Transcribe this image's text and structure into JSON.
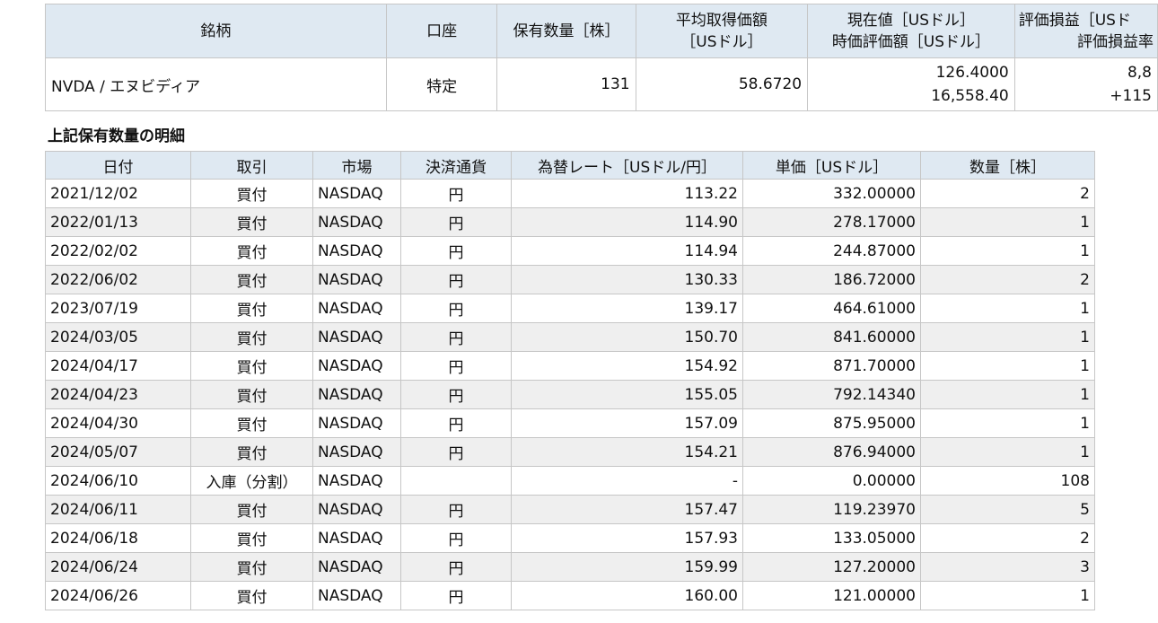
{
  "summary": {
    "headers": {
      "brand": "銘柄",
      "account": "口座",
      "quantity": "保有数量［株］",
      "avg_cost_1": "平均取得価額",
      "avg_cost_2": "［USドル］",
      "current_1": "現在値［USドル］",
      "current_2": "時価評価額［USドル］",
      "pl_1": "評価損益［USド",
      "pl_2": "評価損益率"
    },
    "row": {
      "brand": "NVDA / エヌビディア",
      "account": "特定",
      "quantity": "131",
      "avg_cost": "58.6720",
      "current_price": "126.4000",
      "market_value": "16,558.40",
      "pl": "8,8",
      "pl_rate": "+115"
    }
  },
  "detail": {
    "title": "上記保有数量の明細",
    "headers": {
      "date": "日付",
      "trade": "取引",
      "market": "市場",
      "currency": "決済通貨",
      "fx": "為替レート［USドル/円］",
      "price": "単価［USドル］",
      "qty": "数量［株］"
    },
    "rows": [
      {
        "date": "2021/12/02",
        "trade": "買付",
        "market": "NASDAQ",
        "currency": "円",
        "fx": "113.22",
        "price": "332.00000",
        "qty": "2"
      },
      {
        "date": "2022/01/13",
        "trade": "買付",
        "market": "NASDAQ",
        "currency": "円",
        "fx": "114.90",
        "price": "278.17000",
        "qty": "1"
      },
      {
        "date": "2022/02/02",
        "trade": "買付",
        "market": "NASDAQ",
        "currency": "円",
        "fx": "114.94",
        "price": "244.87000",
        "qty": "1"
      },
      {
        "date": "2022/06/02",
        "trade": "買付",
        "market": "NASDAQ",
        "currency": "円",
        "fx": "130.33",
        "price": "186.72000",
        "qty": "2"
      },
      {
        "date": "2023/07/19",
        "trade": "買付",
        "market": "NASDAQ",
        "currency": "円",
        "fx": "139.17",
        "price": "464.61000",
        "qty": "1"
      },
      {
        "date": "2024/03/05",
        "trade": "買付",
        "market": "NASDAQ",
        "currency": "円",
        "fx": "150.70",
        "price": "841.60000",
        "qty": "1"
      },
      {
        "date": "2024/04/17",
        "trade": "買付",
        "market": "NASDAQ",
        "currency": "円",
        "fx": "154.92",
        "price": "871.70000",
        "qty": "1"
      },
      {
        "date": "2024/04/23",
        "trade": "買付",
        "market": "NASDAQ",
        "currency": "円",
        "fx": "155.05",
        "price": "792.14340",
        "qty": "1"
      },
      {
        "date": "2024/04/30",
        "trade": "買付",
        "market": "NASDAQ",
        "currency": "円",
        "fx": "157.09",
        "price": "875.95000",
        "qty": "1"
      },
      {
        "date": "2024/05/07",
        "trade": "買付",
        "market": "NASDAQ",
        "currency": "円",
        "fx": "154.21",
        "price": "876.94000",
        "qty": "1"
      },
      {
        "date": "2024/06/10",
        "trade": "入庫（分割）",
        "market": "NASDAQ",
        "currency": "",
        "fx": "-",
        "price": "0.00000",
        "qty": "108"
      },
      {
        "date": "2024/06/11",
        "trade": "買付",
        "market": "NASDAQ",
        "currency": "円",
        "fx": "157.47",
        "price": "119.23970",
        "qty": "5"
      },
      {
        "date": "2024/06/18",
        "trade": "買付",
        "market": "NASDAQ",
        "currency": "円",
        "fx": "157.93",
        "price": "133.05000",
        "qty": "2"
      },
      {
        "date": "2024/06/24",
        "trade": "買付",
        "market": "NASDAQ",
        "currency": "円",
        "fx": "159.99",
        "price": "127.20000",
        "qty": "3"
      },
      {
        "date": "2024/06/26",
        "trade": "買付",
        "market": "NASDAQ",
        "currency": "円",
        "fx": "160.00",
        "price": "121.00000",
        "qty": "1"
      }
    ]
  },
  "colors": {
    "header_bg": "#dfe9f2",
    "stripe_bg": "#efefef",
    "border": "#c6c6c6"
  }
}
